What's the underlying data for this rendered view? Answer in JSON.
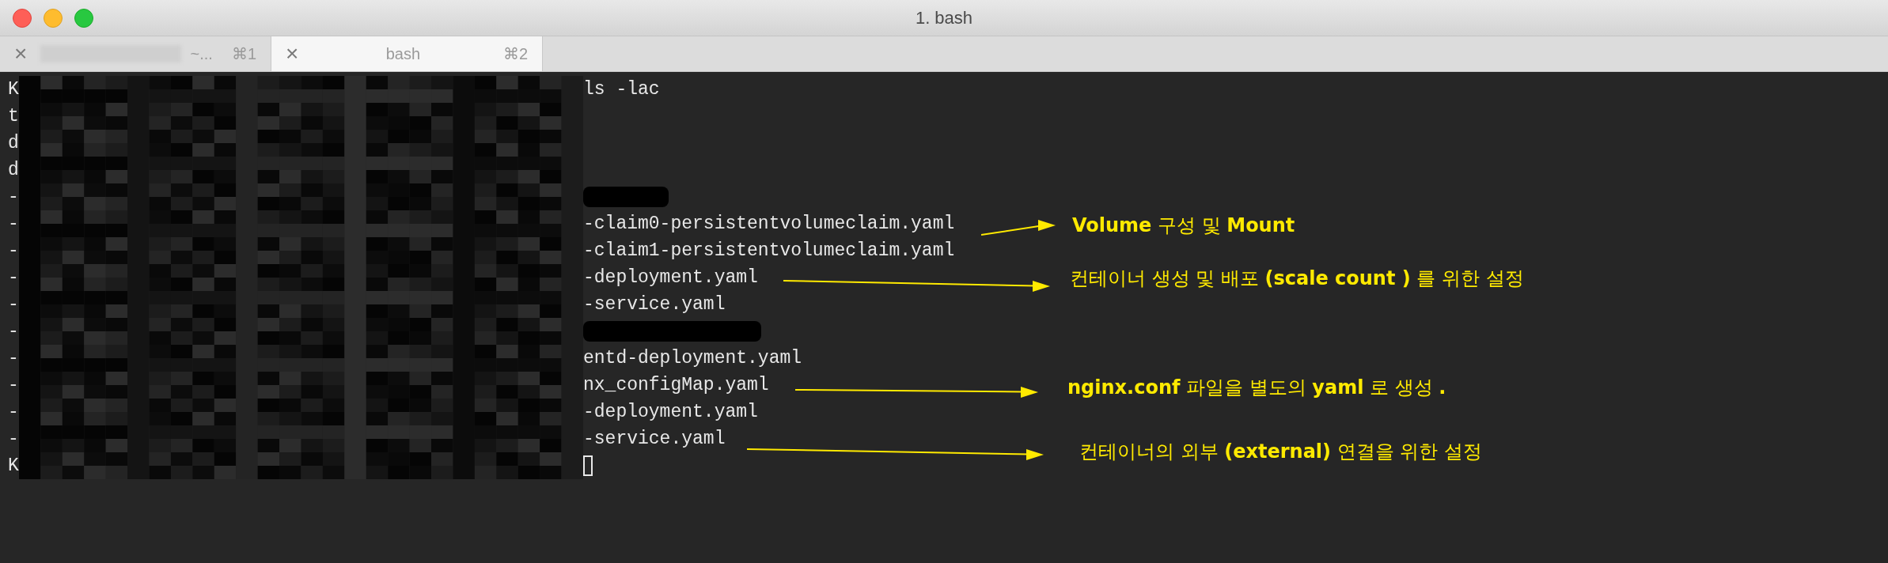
{
  "window": {
    "title": "1. bash"
  },
  "tabs": [
    {
      "close": "×",
      "label": "~...",
      "shortcut": "⌘1",
      "selected": false,
      "redacted": true
    },
    {
      "close": "×",
      "label": "bash",
      "shortcut": "⌘2",
      "selected": true,
      "redacted": false
    }
  ],
  "terminal": {
    "lines": [
      {
        "lead": "K",
        "kind": "text",
        "text": "ls -lac"
      },
      {
        "lead": "t",
        "kind": "empty"
      },
      {
        "lead": "d",
        "kind": "empty"
      },
      {
        "lead": "d",
        "kind": "empty"
      },
      {
        "lead": "-",
        "kind": "shortbar"
      },
      {
        "lead": "-",
        "kind": "text",
        "text": "-claim0-persistentvolumeclaim.yaml"
      },
      {
        "lead": "-",
        "kind": "text",
        "text": "-claim1-persistentvolumeclaim.yaml"
      },
      {
        "lead": "-",
        "kind": "text",
        "text": "-deployment.yaml"
      },
      {
        "lead": "-",
        "kind": "text",
        "text": "-service.yaml"
      },
      {
        "lead": "-",
        "kind": "longbar"
      },
      {
        "lead": "-",
        "kind": "text",
        "text": "entd-deployment.yaml"
      },
      {
        "lead": "-",
        "kind": "text",
        "text": "nx_configMap.yaml"
      },
      {
        "lead": "-",
        "kind": "text",
        "text": "-deployment.yaml"
      },
      {
        "lead": "-",
        "kind": "text",
        "text": "-service.yaml"
      },
      {
        "lead": "K",
        "kind": "cursor"
      }
    ]
  },
  "annotations": [
    {
      "text": "**Volume** 구성 및 **Mount**"
    },
    {
      "text": "컨테이너 생성 및 배포 **(scale count )** 를 위한 설정"
    },
    {
      "text": "**nginx.conf** 파일을 별도의 **yaml** 로 생성 **.**"
    },
    {
      "text": "컨테이너의  외부 **(external)** 연결을 위한 설정"
    }
  ]
}
